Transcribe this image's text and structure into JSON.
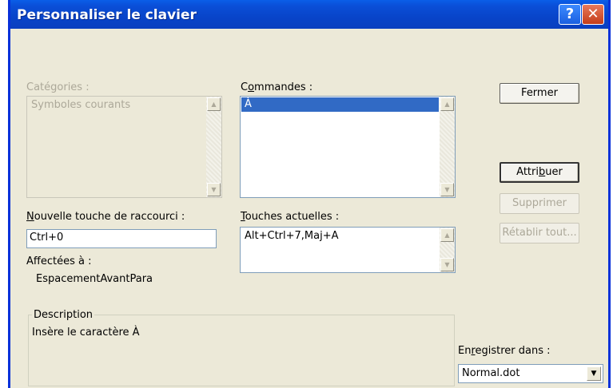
{
  "window": {
    "title": "Personnaliser le clavier",
    "help_glyph": "?",
    "close_glyph": "✕"
  },
  "categories": {
    "label": "Catégories :",
    "items": [
      "Symboles courants"
    ]
  },
  "commands": {
    "label_pre": "C",
    "label_accel": "o",
    "label_post": "mmandes :",
    "items": [
      "À"
    ],
    "selected_index": 0
  },
  "shortcut": {
    "label_accel": "N",
    "label_post": "ouvelle touche de raccourci :",
    "value": "Ctrl+0"
  },
  "assigned": {
    "label": "Affectées à :",
    "value": "EspacementAvantPara"
  },
  "current_keys": {
    "label_accel": "T",
    "label_post": "ouches actuelles :",
    "items": [
      "Alt+Ctrl+7,Maj+A"
    ]
  },
  "buttons": {
    "close": "Fermer",
    "assign_pre": "Attri",
    "assign_accel": "b",
    "assign_post": "uer",
    "remove": "Supprimer",
    "reset": "Rétablir tout..."
  },
  "description": {
    "label": "Description",
    "text": "Insère le caractère À"
  },
  "save_in": {
    "label_pre": "En",
    "label_accel": "r",
    "label_post": "egistrer dans :",
    "value": "Normal.dot"
  },
  "colors": {
    "dialog_bg": "#ece9d8",
    "titlebar": "#0a4fd8",
    "selection": "#316ac5",
    "disabled_text": "#aca899"
  },
  "icons": {
    "scroll_up": "▲",
    "scroll_down": "▼",
    "dropdown": "▼"
  }
}
